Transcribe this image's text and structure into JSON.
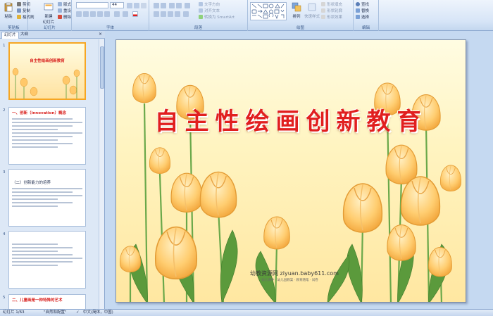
{
  "ribbon": {
    "clipboard": {
      "paste": "粘贴",
      "cut": "剪切",
      "copy": "复制",
      "format_painter": "格式刷",
      "label": "剪贴板"
    },
    "slides": {
      "new_slide": "新建\n幻灯片",
      "layout": "版式",
      "reset": "重设",
      "delete": "删除",
      "label": "幻灯片"
    },
    "font": {
      "font_size": "44",
      "label": "字体"
    },
    "paragraph": {
      "text_direction": "文字方向",
      "align_text": "对齐文本",
      "smartart": "转换为 SmartArt",
      "label": "段落"
    },
    "drawing": {
      "arrange": "排列",
      "quick_styles": "快速样式",
      "shape_fill": "形状填充",
      "shape_outline": "形状轮廓",
      "shape_effects": "形状效果",
      "label": "绘图"
    },
    "editing": {
      "find": "查找",
      "replace": "替换",
      "select": "选择",
      "label": "编辑"
    }
  },
  "panel": {
    "tabs": [
      "幻灯片",
      "大纲"
    ],
    "thumbs": [
      {
        "num": "1",
        "title": "自主性绘画创新教育"
      },
      {
        "num": "2",
        "title": "一、创新（innovation）概念"
      },
      {
        "num": "3",
        "title": "（二）创新能力的培养"
      },
      {
        "num": "4",
        "title": ""
      },
      {
        "num": "5",
        "title": "二、儿童画是一种特殊的艺术"
      }
    ]
  },
  "slide": {
    "title": "自主性绘画创新教育",
    "watermark": "幼教资源网 ziyuan.baby611.com",
    "watermark_sub": "·幼儿课件 · 幼儿园教案 · 教育随笔 · 试卷"
  },
  "status": {
    "slide_count": "幻灯片 1/63",
    "theme": "\"自然和配置\"",
    "language": "中文(简体，中国)"
  },
  "colors": {
    "title_red": "#e11f1f",
    "selection": "#f6a623",
    "tulip": "#ffc86a"
  }
}
